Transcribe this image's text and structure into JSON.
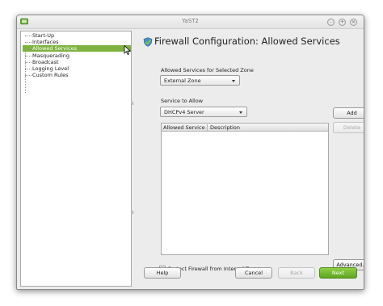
{
  "window": {
    "title": "YaST2",
    "app_icon": "yast-icon",
    "controls": {
      "minimize": "–",
      "maximize": "+",
      "close": "×"
    }
  },
  "sidebar": {
    "items": [
      {
        "label": "Start-Up",
        "selected": false
      },
      {
        "label": "Interfaces",
        "selected": false
      },
      {
        "label": "Allowed Services",
        "selected": true
      },
      {
        "label": "Masquerading",
        "selected": false
      },
      {
        "label": "Broadcast",
        "selected": false
      },
      {
        "label": "Logging Level",
        "selected": false
      },
      {
        "label": "Custom Rules",
        "selected": false
      }
    ],
    "selected_color": "#7fb23e"
  },
  "main": {
    "heading": "Firewall Configuration: Allowed Services",
    "heading_icon": "firewall-shield-icon",
    "zone_label": "Allowed Services for Selected Zone",
    "zone_value": "External Zone",
    "service_label": "Service to Allow",
    "service_value": "DHCPv4 Server",
    "table": {
      "columns": [
        "Allowed Service",
        "Description"
      ],
      "rows": []
    },
    "add_button": "Add",
    "delete_button": "Delete",
    "advanced_button": "Advanced...",
    "protect_label": "Protect Firewall from Internal Zone",
    "protect_checked": false
  },
  "footer": {
    "help": "Help",
    "cancel": "Cancel",
    "back": "Back",
    "next": "Next",
    "accent": "#6ab52a"
  }
}
